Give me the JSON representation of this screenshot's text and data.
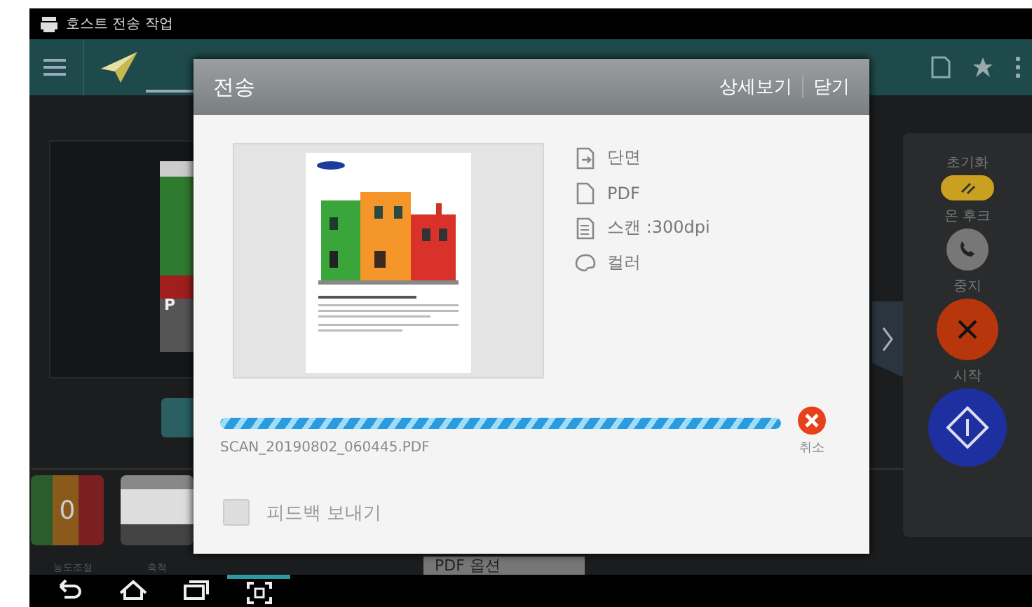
{
  "status_bar": {
    "title": "호스트 전송 작업"
  },
  "background": {
    "preview_label": "P",
    "thumbnail_count": "0",
    "thumbnail_labels": [
      "농도조절",
      "축척"
    ],
    "option_label": "PDF 옵션"
  },
  "dialog": {
    "title": "전송",
    "actions": [
      "상세보기",
      "닫기"
    ],
    "settings": [
      {
        "kind": "duplex",
        "label": "단면"
      },
      {
        "kind": "file",
        "label": "PDF"
      },
      {
        "kind": "scan",
        "label": "스캔 :300dpi"
      },
      {
        "kind": "color",
        "label": "컬러"
      }
    ],
    "progress": {
      "level": 1
    },
    "file_name": "SCAN_20190802_060445.PDF",
    "cancel_label": "취소",
    "feedback": {
      "label": "피드백 보내기",
      "checked": false
    }
  },
  "side_panel": {
    "buttons": [
      {
        "kind": "reset",
        "label": "초기화"
      },
      {
        "kind": "hook",
        "label": "온 후크"
      },
      {
        "kind": "stop",
        "label": "중지"
      },
      {
        "kind": "start",
        "label": "시작"
      }
    ]
  },
  "nav_bar": [
    {
      "kind": "back",
      "selected": false
    },
    {
      "kind": "home",
      "selected": false
    },
    {
      "kind": "recent",
      "selected": false
    },
    {
      "kind": "capture",
      "selected": true
    }
  ]
}
